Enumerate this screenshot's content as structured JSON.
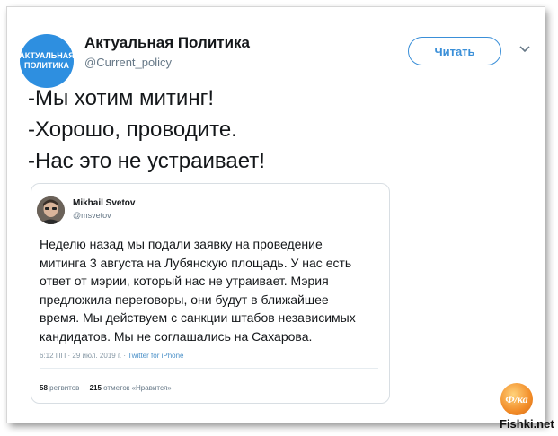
{
  "account": {
    "avatar_lines": [
      "АКТУАЛЬНАЯ",
      "ПОЛИТИКА"
    ],
    "name": "Актуальная Политика",
    "handle": "@Current_policy",
    "follow_label": "Читать"
  },
  "tweet": {
    "lines": [
      "-Мы хотим митинг!",
      "-Хорошо, проводите.",
      "-Нас это не устраивает!"
    ]
  },
  "quoted": {
    "name": "Mikhail Svetov",
    "handle": "@msvetov",
    "lines": [
      "Неделю назад мы подали заявку на проведение",
      "митинга 3 августа на Лубянскую площадь. У нас есть",
      "ответ от мэрии, который нас не утраивает. Мэрия",
      "предложила переговоры, они будут в ближайшее",
      "время. Мы действуем с санкции штабов независимых",
      "кандидатов. Мы не соглашались на Сахарова."
    ],
    "time": "6:12 ПП · 29 июл. 2019 г. ·",
    "source": "Twitter for iPhone",
    "retweets_count": "58",
    "retweets_label": "ретвитов",
    "likes_count": "215",
    "likes_label": "отметок «Нравится»"
  },
  "branding": {
    "badge_text": "Ф/ка",
    "watermark": "Fishki.net"
  },
  "colors": {
    "accent": "#3a8fd8",
    "avatar_bg": "#2e8fe0",
    "text": "#14171a",
    "muted": "#657786"
  }
}
